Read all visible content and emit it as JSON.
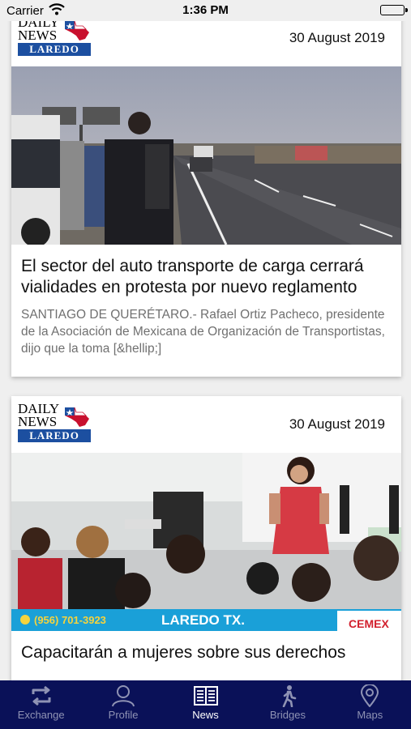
{
  "status_bar": {
    "carrier": "Carrier",
    "time": "1:36 PM"
  },
  "logo": {
    "line1": "DAILY",
    "line2": "NEWS",
    "ribbon": "LAREDO"
  },
  "articles": [
    {
      "date": "30 August 2019",
      "title": "El sector del auto transporte de carga cerrará vialidades en protesta por nuevo reglamento",
      "excerpt": "SANTIAGO DE QUERÉTARO.- Rafael Ortiz Pacheco, presidente de la Asociación de Mexicana de Organización de Transportistas, dijo que la toma [&hellip;]"
    },
    {
      "date": "30 August 2019",
      "title": "Capacitarán a mujeres sobre sus derechos",
      "photo_banner": {
        "phone": "(956) 701-3923",
        "city": "LAREDO TX.",
        "brand": "CEMEX"
      }
    }
  ],
  "tab_bar": {
    "active": "News",
    "items": [
      {
        "label": "Exchange",
        "icon": "exchange-icon"
      },
      {
        "label": "Profile",
        "icon": "profile-icon"
      },
      {
        "label": "News",
        "icon": "news-icon"
      },
      {
        "label": "Bridges",
        "icon": "bridges-icon"
      },
      {
        "label": "Maps",
        "icon": "maps-icon"
      }
    ]
  },
  "colors": {
    "tab_bar_bg": "#0a1158",
    "logo_ribbon": "#1c4fa0",
    "banner_bg": "#1aa0d8"
  }
}
